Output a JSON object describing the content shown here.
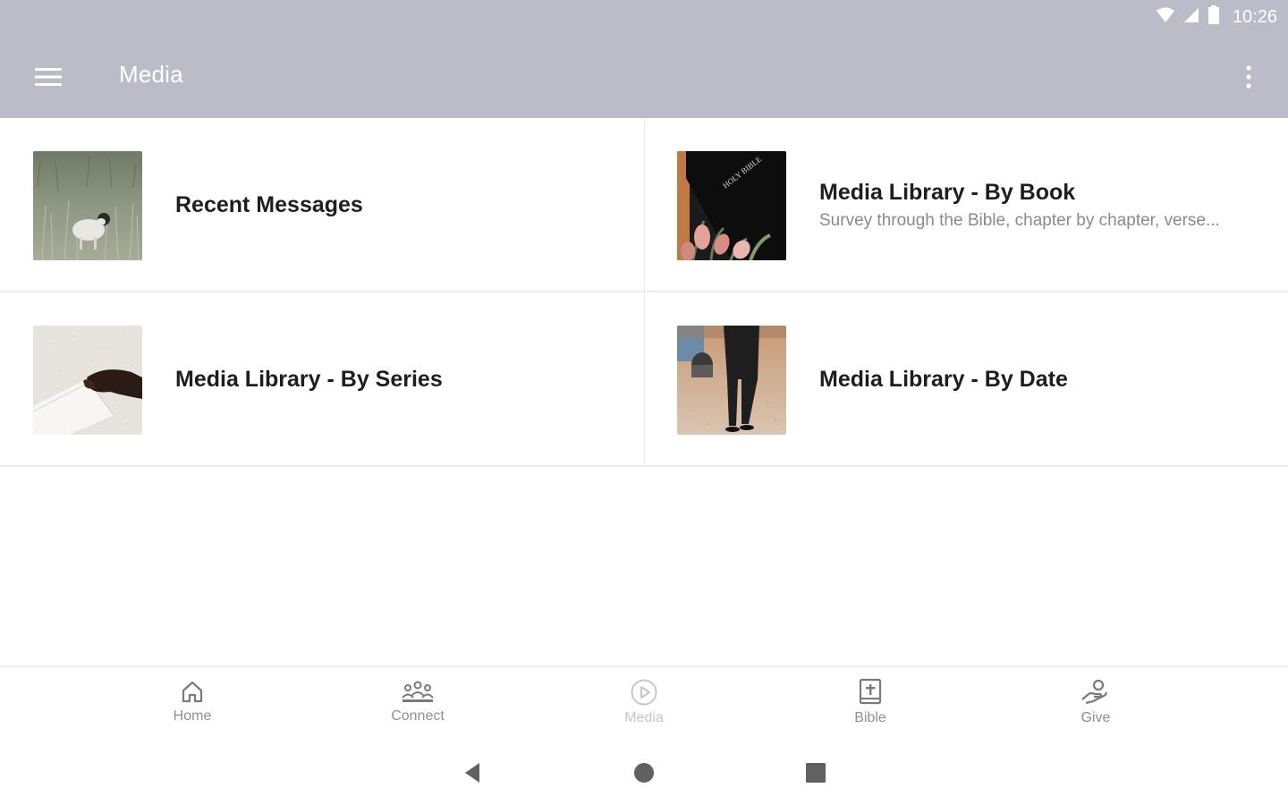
{
  "status_bar": {
    "time": "10:26",
    "icons": [
      "wifi-icon",
      "cell-signal-icon",
      "battery-icon"
    ]
  },
  "app_bar": {
    "title": "Media",
    "menu_icon": "hamburger-menu-icon",
    "overflow_icon": "more-vert-icon"
  },
  "colors": {
    "header": "#bbbcc8",
    "card_title": "#1e1e1e",
    "card_subtitle": "#8a8a8a",
    "nav_label": "#8f8f8f",
    "nav_active": "#c6c6cc"
  },
  "cards": [
    {
      "title": "Recent Messages",
      "subtitle": "",
      "thumbnail": "lamb-in-grass-image"
    },
    {
      "title": "Media Library - By Book",
      "subtitle": "Survey through the Bible, chapter by chapter, verse...",
      "thumbnail": "holy-bible-with-tulips-image",
      "thumbnail_text": "HOLY BIBLE"
    },
    {
      "title": "Media Library - By Series",
      "subtitle": "",
      "thumbnail": "hand-on-book-pages-image"
    },
    {
      "title": "Media Library - By Date",
      "subtitle": "",
      "thumbnail": "person-walking-image"
    }
  ],
  "bottom_nav": {
    "items": [
      {
        "label": "Home",
        "icon": "home-icon",
        "active": false
      },
      {
        "label": "Connect",
        "icon": "people-group-icon",
        "active": false
      },
      {
        "label": "Media",
        "icon": "play-circle-icon",
        "active": true
      },
      {
        "label": "Bible",
        "icon": "bible-book-icon",
        "active": false
      },
      {
        "label": "Give",
        "icon": "giving-hand-icon",
        "active": false
      }
    ]
  },
  "system_nav": {
    "buttons": [
      "back-icon",
      "home-circle-icon",
      "recents-square-icon"
    ]
  }
}
